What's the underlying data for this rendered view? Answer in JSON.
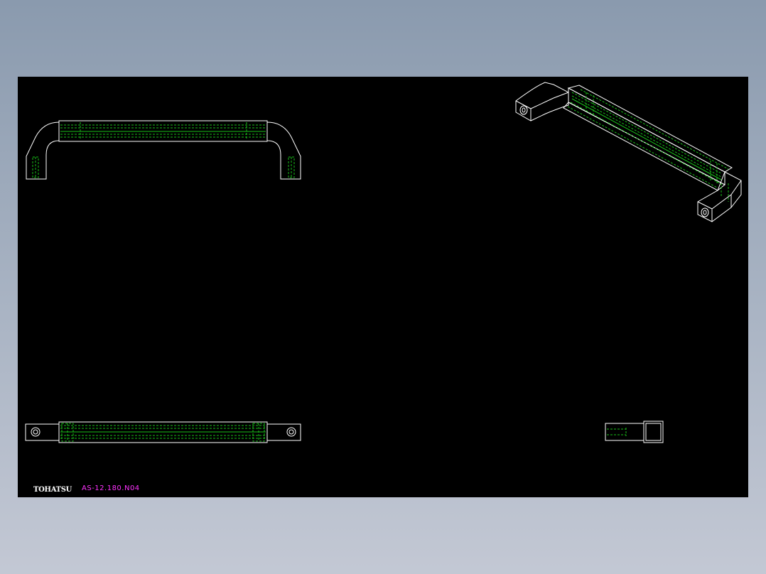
{
  "drawing": {
    "brand_label": "TOHATSU",
    "part_number": "AS-12.180.N04"
  },
  "colors": {
    "viewport_background": "#8a9aae",
    "sheet_background": "#000000",
    "outline": "#ffffff",
    "hidden_lines": "#19c019",
    "part_number_text": "#ff33ff"
  },
  "views": [
    "front-view",
    "top-view",
    "side-view",
    "isometric-view"
  ]
}
